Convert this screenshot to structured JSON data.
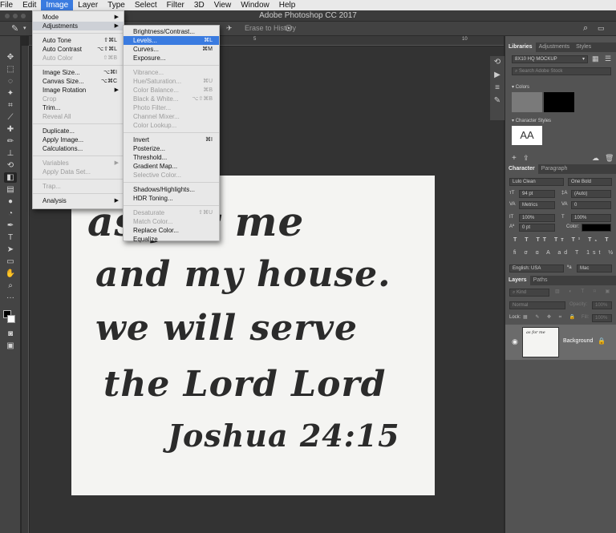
{
  "menubar": {
    "items": [
      "File",
      "Edit",
      "Image",
      "Layer",
      "Type",
      "Select",
      "Filter",
      "3D",
      "View",
      "Window",
      "Help"
    ]
  },
  "window_title": "Adobe Photoshop CC 2017",
  "options": {
    "erase_history": "Erase to History"
  },
  "image_menu": [
    {
      "label": "Mode",
      "shortcut": "",
      "submenu": true,
      "disabled": false
    },
    {
      "label": "Adjustments",
      "shortcut": "",
      "submenu": true,
      "disabled": false
    },
    {
      "label": "Auto Tone",
      "shortcut": "⇧⌘L",
      "disabled": false
    },
    {
      "label": "Auto Contrast",
      "shortcut": "⌥⇧⌘L",
      "disabled": false
    },
    {
      "label": "Auto Color",
      "shortcut": "⇧⌘B",
      "disabled": true
    },
    {
      "label": "Image Size...",
      "shortcut": "⌥⌘I",
      "disabled": false
    },
    {
      "label": "Canvas Size...",
      "shortcut": "⌥⌘C",
      "disabled": false
    },
    {
      "label": "Image Rotation",
      "shortcut": "",
      "submenu": true,
      "disabled": false
    },
    {
      "label": "Crop",
      "shortcut": "",
      "disabled": true
    },
    {
      "label": "Trim...",
      "shortcut": "",
      "disabled": false
    },
    {
      "label": "Reveal All",
      "shortcut": "",
      "disabled": true
    },
    {
      "label": "Duplicate...",
      "shortcut": "",
      "disabled": false
    },
    {
      "label": "Apply Image...",
      "shortcut": "",
      "disabled": false
    },
    {
      "label": "Calculations...",
      "shortcut": "",
      "disabled": false
    },
    {
      "label": "Variables",
      "shortcut": "",
      "submenu": true,
      "disabled": true
    },
    {
      "label": "Apply Data Set...",
      "shortcut": "",
      "disabled": true
    },
    {
      "label": "Trap...",
      "shortcut": "",
      "disabled": true
    },
    {
      "label": "Analysis",
      "shortcut": "",
      "submenu": true,
      "disabled": false
    }
  ],
  "adjustments_menu": [
    {
      "label": "Brightness/Contrast...",
      "shortcut": "",
      "disabled": false
    },
    {
      "label": "Levels...",
      "shortcut": "⌘L",
      "disabled": false
    },
    {
      "label": "Curves...",
      "shortcut": "⌘M",
      "disabled": false
    },
    {
      "label": "Exposure...",
      "shortcut": "",
      "disabled": false
    },
    {
      "label": "Vibrance...",
      "shortcut": "",
      "disabled": true
    },
    {
      "label": "Hue/Saturation...",
      "shortcut": "⌘U",
      "disabled": true
    },
    {
      "label": "Color Balance...",
      "shortcut": "⌘B",
      "disabled": true
    },
    {
      "label": "Black & White...",
      "shortcut": "⌥⇧⌘B",
      "disabled": true
    },
    {
      "label": "Photo Filter...",
      "shortcut": "",
      "disabled": true
    },
    {
      "label": "Channel Mixer...",
      "shortcut": "",
      "disabled": true
    },
    {
      "label": "Color Lookup...",
      "shortcut": "",
      "disabled": true
    },
    {
      "label": "Invert",
      "shortcut": "⌘I",
      "disabled": false
    },
    {
      "label": "Posterize...",
      "shortcut": "",
      "disabled": false
    },
    {
      "label": "Threshold...",
      "shortcut": "",
      "disabled": false
    },
    {
      "label": "Gradient Map...",
      "shortcut": "",
      "disabled": false
    },
    {
      "label": "Selective Color...",
      "shortcut": "",
      "disabled": true
    },
    {
      "label": "Shadows/Highlights...",
      "shortcut": "",
      "disabled": false
    },
    {
      "label": "HDR Toning...",
      "shortcut": "",
      "disabled": false
    },
    {
      "label": "Desaturate",
      "shortcut": "⇧⌘U",
      "disabled": true
    },
    {
      "label": "Match Color...",
      "shortcut": "",
      "disabled": true
    },
    {
      "label": "Replace Color...",
      "shortcut": "",
      "disabled": false
    },
    {
      "label": "Equalize",
      "shortcut": "",
      "disabled": false
    }
  ],
  "artwork_text": [
    "as for me",
    "and my house.",
    "we will serve",
    "the Lord Lord",
    "Joshua 24:15"
  ],
  "libraries": {
    "tabs": [
      "Libraries",
      "Adjustments",
      "Styles"
    ],
    "library_name": "8X10 HQ MOCKUP",
    "search_placeholder": "Search Adobe Stock",
    "colors_label": "Colors",
    "color_swatches": [
      "#7a7a7a",
      "#000000"
    ],
    "char_styles_label": "Character Styles",
    "char_style_sample": "AA"
  },
  "character": {
    "tabs": [
      "Character",
      "Paragraph"
    ],
    "font_family": "Lulo Clean",
    "font_style": "One Bold",
    "font_size": "94 pt",
    "leading": "(Auto)",
    "kerning": "Metrics",
    "tracking": "0",
    "vscale": "100%",
    "hscale": "100%",
    "baseline": "0 pt",
    "color_label": "Color:",
    "language": "English: USA",
    "antialias": "Mac"
  },
  "layers": {
    "tabs": [
      "Layers",
      "Paths"
    ],
    "filter": "Kind",
    "blend_mode": "Normal",
    "opacity_label": "Opacity:",
    "opacity": "100%",
    "lock_label": "Lock:",
    "fill_label": "Fill:",
    "fill": "100%",
    "layer_name": "Background"
  }
}
